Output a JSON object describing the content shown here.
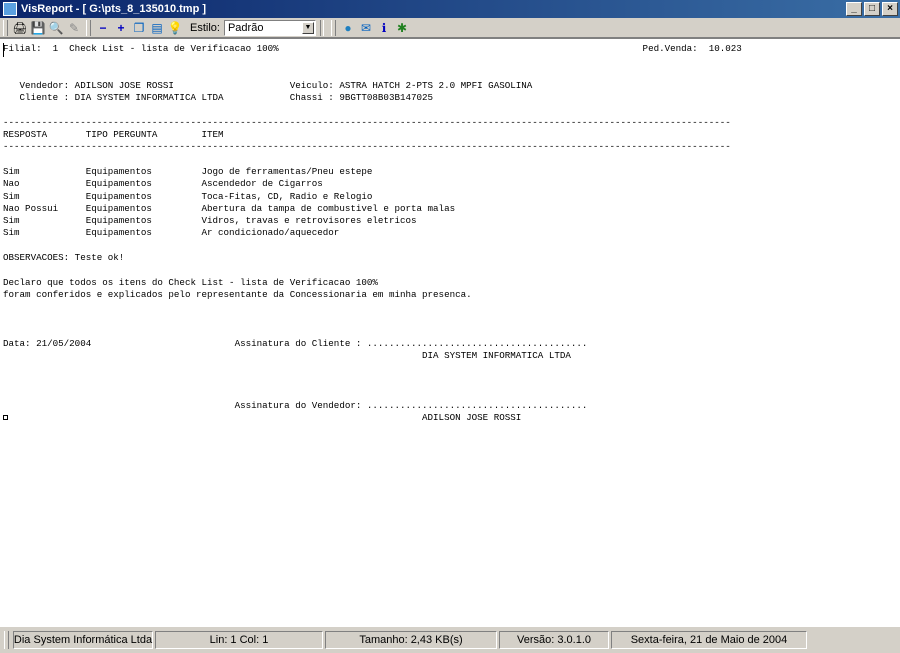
{
  "window": {
    "title": "VisReport - [ G:\\pts_8_135010.tmp ]"
  },
  "toolbar": {
    "estilo_label": "Estilo:",
    "estilo_value": "Padrão",
    "buttons": [
      "print",
      "save",
      "preview",
      "page-setup",
      "zoom-out",
      "zoom-in",
      "copy",
      "export",
      "tip",
      "web",
      "mail",
      "info",
      "tools"
    ]
  },
  "report": {
    "lines": [
      "Filial:  1  Check List - lista de Verificacao 100%                                                                  Ped.Venda:  10.023",
      "",
      "",
      "   Vendedor: ADILSON JOSE ROSSI                     Veiculo: ASTRA HATCH 2-PTS 2.0 MPFI GASOLINA",
      "   Cliente : DIA SYSTEM INFORMATICA LTDA            Chassi : 9BGTT08B03B147025",
      "",
      "------------------------------------------------------------------------------------------------------------------------------------",
      "RESPOSTA       TIPO PERGUNTA        ITEM",
      "------------------------------------------------------------------------------------------------------------------------------------",
      "",
      "Sim            Equipamentos         Jogo de ferramentas/Pneu estepe",
      "Nao            Equipamentos         Ascendedor de Cigarros",
      "Sim            Equipamentos         Toca-Fitas, CD, Radio e Relogio",
      "Nao Possui     Equipamentos         Abertura da tampa de combustivel e porta malas",
      "Sim            Equipamentos         Vidros, travas e retrovisores eletricos",
      "Sim            Equipamentos         Ar condicionado/aquecedor",
      "",
      "OBSERVACOES: Teste ok!",
      "",
      "Declaro que todos os itens do Check List - lista de Verificacao 100%",
      "foram conferidos e explicados pelo representante da Concessionaria em minha presenca.",
      "",
      "",
      "",
      "Data: 21/05/2004                          Assinatura do Cliente : ........................................",
      "                                                                            DIA SYSTEM INFORMATICA LTDA",
      "",
      "",
      "",
      "                                          Assinatura do Vendedor: ........................................",
      "                                                                            ADILSON JOSE ROSSI"
    ]
  },
  "status": {
    "company": "Dia System Informática Ltda",
    "position": "Lin:  1  Col:  1",
    "size": "Tamanho: 2,43 KB(s)",
    "version": "Versão: 3.0.1.0",
    "date": "Sexta-feira, 21 de Maio de 2004"
  },
  "colors": {
    "titlebar": "#0a246a",
    "chrome": "#d4d0c8",
    "paper": "#ffffff"
  }
}
